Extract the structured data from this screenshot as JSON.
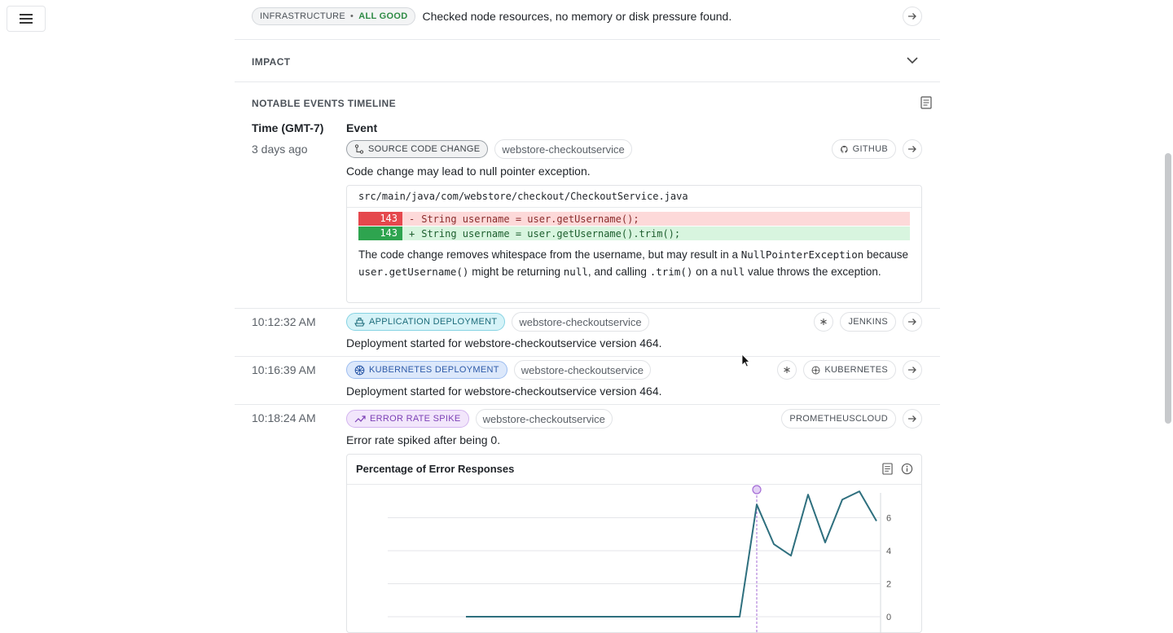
{
  "infra_row": {
    "badge_category": "INFRASTRUCTURE",
    "badge_sep": "•",
    "badge_status": "ALL GOOD",
    "text": "Checked node resources, no memory or disk pressure found."
  },
  "impact": {
    "label": "IMPACT"
  },
  "timeline": {
    "title": "NOTABLE EVENTS TIMELINE",
    "col_time": "Time (GMT-7)",
    "col_event": "Event",
    "events": [
      {
        "time": "3 days ago",
        "type": "SOURCE CODE CHANGE",
        "service": "webstore-checkoutservice",
        "source": "GITHUB",
        "description": "Code change may lead to null pointer exception."
      },
      {
        "time": "10:12:32 AM",
        "type": "APPLICATION DEPLOYMENT",
        "service": "webstore-checkoutservice",
        "source": "JENKINS",
        "description": "Deployment started for webstore-checkoutservice version 464."
      },
      {
        "time": "10:16:39 AM",
        "type": "KUBERNETES DEPLOYMENT",
        "service": "webstore-checkoutservice",
        "source": "KUBERNETES",
        "description": "Deployment started for webstore-checkoutservice version 464."
      },
      {
        "time": "10:18:24 AM",
        "type": "ERROR RATE SPIKE",
        "service": "webstore-checkoutservice",
        "source": "PROMETHEUSCLOUD",
        "description": "Error rate spiked after being 0."
      }
    ]
  },
  "code_change": {
    "file": "src/main/java/com/webstore/checkout/CheckoutService.java",
    "removed": {
      "line": "143",
      "sign": "-",
      "code": "String username = user.getUsername();"
    },
    "added": {
      "line": "143",
      "sign": "+",
      "code": "String username = user.getUsername().trim();"
    },
    "explanation": {
      "p1": "The code change removes whitespace from the username, but may result in a ",
      "c1": "NullPointerException",
      "p2": " because ",
      "c2": "user.getUsername()",
      "p3": " might be returning ",
      "c3": "null",
      "p4": ", and calling ",
      "c4": ".trim()",
      "p5": " on a ",
      "c5": "null",
      "p6": " value throws the exception."
    }
  },
  "chart_data": {
    "type": "line",
    "title": "Percentage of Error Responses",
    "y_ticks": [
      "6",
      "4",
      "2",
      "0"
    ],
    "ylim": [
      0,
      8
    ],
    "x": [
      0,
      1,
      2,
      3,
      4,
      5,
      6,
      7,
      8,
      9,
      10,
      11,
      12,
      13,
      14,
      15,
      16,
      17,
      18,
      19,
      20,
      21,
      22
    ],
    "series": [
      {
        "values": [
          0,
          0,
          0,
          0,
          0,
          0,
          0,
          0,
          0,
          0,
          0,
          0,
          0,
          0,
          0,
          0,
          0,
          6.8,
          4.4,
          3.7,
          7.4,
          4.5,
          7.1,
          7.6,
          5.8
        ]
      }
    ],
    "event_marker_index": 17,
    "colors": {
      "line": "#2e6f7e",
      "marker": "#a46cd6",
      "grid": "#e4e6e9"
    }
  }
}
